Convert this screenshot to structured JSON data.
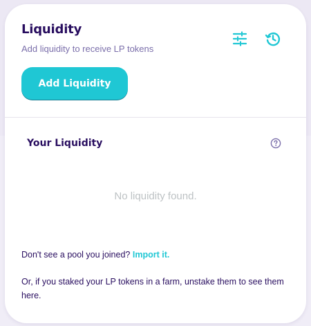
{
  "header": {
    "title": "Liquidity",
    "subtitle": "Add liquidity to receive LP tokens",
    "settings_icon": "settings-sliders-icon",
    "history_icon": "history-clock-icon"
  },
  "actions": {
    "add_liquidity_label": "Add Liquidity"
  },
  "your_liquidity": {
    "title": "Your Liquidity",
    "help_icon": "question-circle-icon",
    "empty_message": "No liquidity found."
  },
  "footer": {
    "pool_prompt": "Don't see a pool you joined?",
    "import_link": "Import it.",
    "unstake_note": "Or, if you staked your LP tokens in a farm, unstake them to see them here."
  },
  "colors": {
    "primary": "#1fc7d4",
    "text": "#280d5f",
    "text_subtle": "#7a6eaa",
    "disabled_text": "#bdc2c4",
    "background": "#ece8f4",
    "card": "#ffffff"
  }
}
